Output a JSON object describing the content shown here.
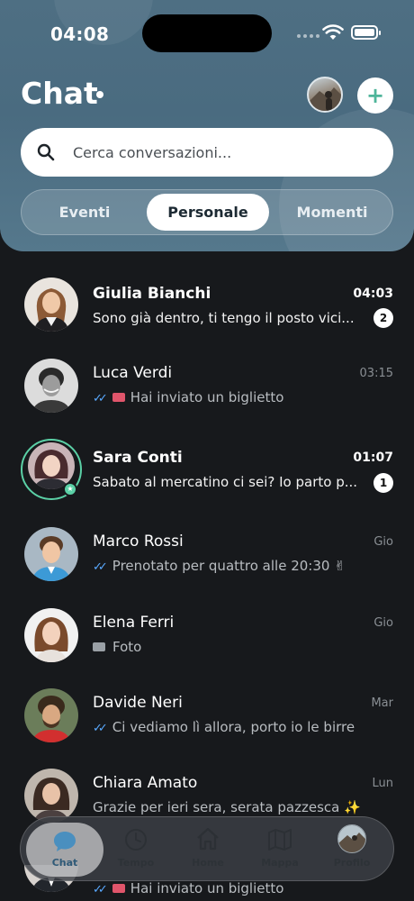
{
  "status_bar": {
    "time": "04:08"
  },
  "header": {
    "title": "Chat",
    "add_label": "+"
  },
  "search": {
    "placeholder": "Cerca conversazioni..."
  },
  "tabs": [
    {
      "label": "Eventi"
    },
    {
      "label": "Personale"
    },
    {
      "label": "Momenti"
    }
  ],
  "chats": [
    {
      "name": "Giulia Bianchi",
      "time": "04:03",
      "preview": "Sono già dentro, ti tengo il posto vici...",
      "unread": "2"
    },
    {
      "name": "Luca Verdi",
      "time": "03:15",
      "preview": "Hai inviato un biglietto",
      "ticks": "✓✓"
    },
    {
      "name": "Sara Conti",
      "time": "01:07",
      "preview": "Sabato al mercatino ci sei? Io parto p...",
      "unread": "1"
    },
    {
      "name": "Marco Rossi",
      "time": "Gio",
      "preview": "Prenotato per quattro alle 20:30 ✌",
      "ticks": "✓✓"
    },
    {
      "name": "Elena Ferri",
      "time": "Gio",
      "preview": "Foto"
    },
    {
      "name": "Davide Neri",
      "time": "Mar",
      "preview": "Ci vediamo lì allora, porto io le birre",
      "ticks": "✓✓"
    },
    {
      "name": "Chiara Amato",
      "time": "Lun",
      "preview": "Grazie per ieri sera, serata pazzesca ✨"
    },
    {
      "name": "",
      "time": "",
      "preview": "Hai inviato un biglietto",
      "ticks": "✓✓"
    }
  ],
  "nav": [
    {
      "label": "Chat"
    },
    {
      "label": "Tempo"
    },
    {
      "label": "Home"
    },
    {
      "label": "Mappa"
    },
    {
      "label": "Profilo"
    }
  ],
  "colors": {
    "accent": "#5bd0a6",
    "header": "#4e6f83",
    "background": "#17191c",
    "read_ticks": "#59a9ff"
  }
}
